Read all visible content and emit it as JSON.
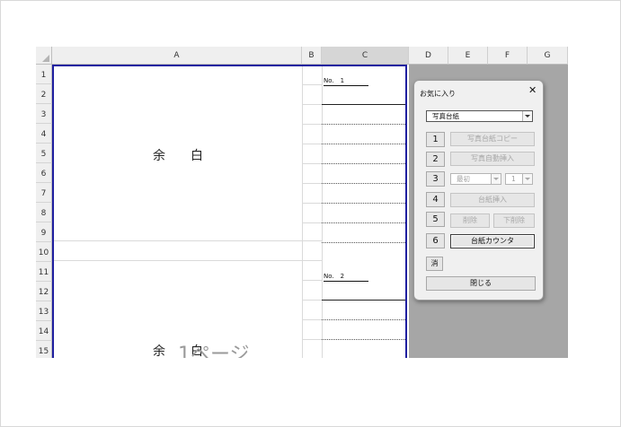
{
  "spreadsheet": {
    "columns": [
      "A",
      "B",
      "C",
      "D",
      "E",
      "F",
      "G"
    ],
    "rows": [
      "1",
      "2",
      "3",
      "4",
      "5",
      "6",
      "7",
      "8",
      "9",
      "10",
      "11",
      "12",
      "13",
      "14",
      "15"
    ],
    "blank_text": "余　　白",
    "watermark_text": "1ページ",
    "number_labels": [
      "No.　1",
      "No.　2"
    ]
  },
  "dialog": {
    "title": "お気に入り",
    "close_glyph": "✕",
    "sheet_select": "写真台紙",
    "row_numbers": [
      "1",
      "2",
      "3",
      "4",
      "5",
      "6"
    ],
    "buttons": {
      "copy_sheet": "写真台紙コピー",
      "auto_insert": "写真自動挿入",
      "position_select": "最初",
      "count_select": "1",
      "insert_sheet": "台紙挿入",
      "delete": "削除",
      "delete_below": "下削除",
      "sheet_counter": "台紙カウンタ",
      "clear": "消",
      "close": "閉じる"
    }
  }
}
